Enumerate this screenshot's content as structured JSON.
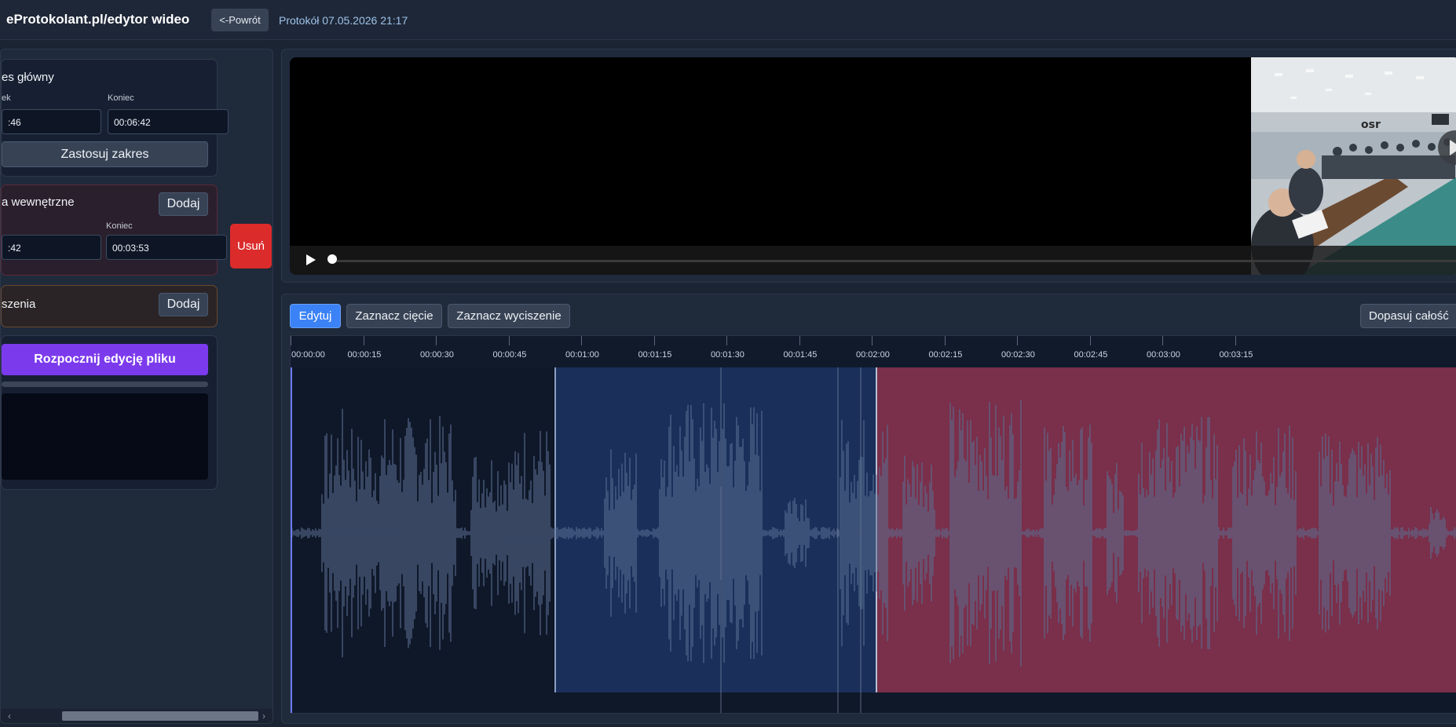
{
  "header": {
    "brand": "eProtokolant.pl/edytor wideo",
    "back_label": "<-Powrót",
    "protocol_label": "Protokół 07.05.2026 21:17"
  },
  "sidebar": {
    "main_range": {
      "title": "es główny",
      "start_label": "ek",
      "end_label": "Koniec",
      "start_value": ":46",
      "end_value": "00:06:42",
      "apply_label": "Zastosuj zakres"
    },
    "inner_cuts": {
      "title": "a wewnętrzne",
      "add_label": "Dodaj",
      "end_label": "Koniec",
      "start_value": ":42",
      "end_value": "00:03:53",
      "delete_label": "Usuń"
    },
    "silences": {
      "title": "szenia",
      "add_label": "Dodaj"
    },
    "start_edit": {
      "label": "Rozpocznij edycję pliku"
    }
  },
  "video": {
    "play_icon": "play-icon"
  },
  "timeline": {
    "buttons": {
      "edit": "Edytuj",
      "mark_cut": "Zaznacz cięcie",
      "mark_silence": "Zaznacz wyciszenie",
      "fit_all": "Dopasuj całość"
    },
    "ticks": [
      "00:00:00",
      "00:00:15",
      "00:00:30",
      "00:00:45",
      "00:01:00",
      "00:01:15",
      "00:01:30",
      "00:01:45",
      "00:02:00",
      "00:02:15",
      "00:02:30",
      "00:02:45",
      "00:03:00",
      "00:03:15"
    ],
    "colors": {
      "cut": "#1a2f5a",
      "silence": "#7a2f4a",
      "wave": "#5b6f93",
      "playhead": "#6b7cff"
    }
  }
}
